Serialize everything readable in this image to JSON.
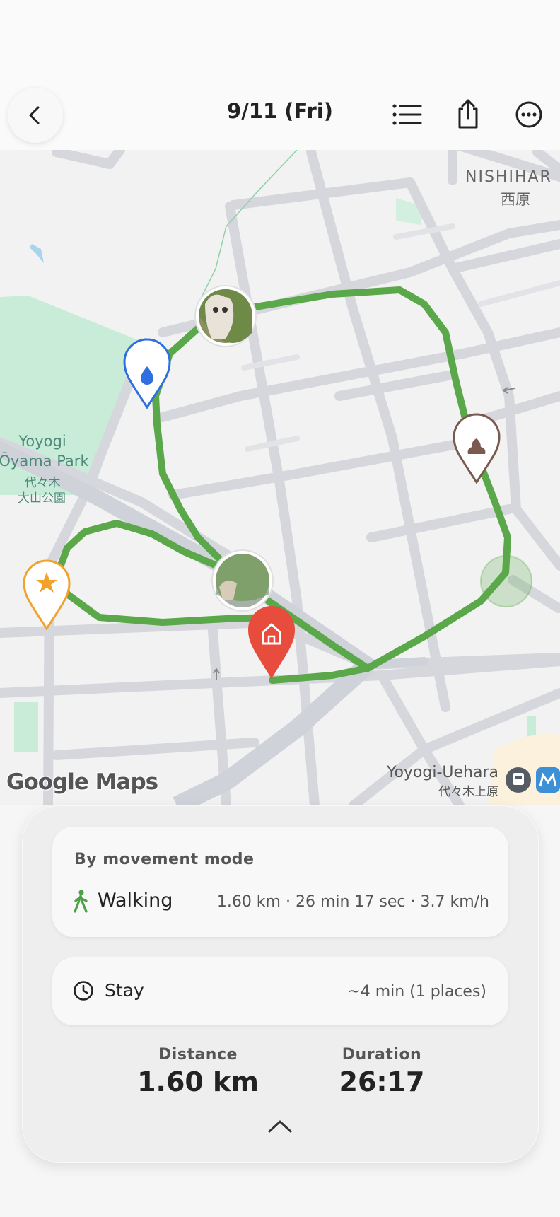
{
  "header": {
    "title": "9/11 (Fri)",
    "back_icon": "chevron-left-icon",
    "list_icon": "list-icon",
    "share_icon": "share-icon",
    "more_icon": "more-icon"
  },
  "map": {
    "labels": {
      "nishihara_en": "NISHIHAR",
      "nishihara_ja": "西原",
      "park_en_1": "Yoyogi",
      "park_en_2": "Ōyama Park",
      "park_ja_1": "代々木",
      "park_ja_2": "大山公園",
      "station_en": "Yoyogi-Uehara",
      "station_ja": "代々木上原"
    },
    "attribution": "Google Maps",
    "route_color": "#5aa84a",
    "markers": [
      "water-icon",
      "poop-icon",
      "star-icon",
      "home-icon",
      "dog-photo",
      "dog-photo"
    ]
  },
  "summary": {
    "movement": {
      "title": "By movement mode",
      "mode_icon": "walking-icon",
      "mode": "Walking",
      "stats": "1.60 km · 26 min 17 sec · 3.7 km/h"
    },
    "stay": {
      "icon": "clock-icon",
      "label": "Stay",
      "value": "~4 min (1 places)"
    },
    "distance": {
      "label": "Distance",
      "value": "1.60 km"
    },
    "duration": {
      "label": "Duration",
      "value": "26:17"
    },
    "expand_icon": "chevron-up-icon"
  },
  "colors": {
    "accent_green": "#5aa84a",
    "water_blue": "#2f6fe0",
    "home_red": "#e84c3d",
    "star_orange": "#f2a22a",
    "poop_brown": "#7a5a4e"
  }
}
